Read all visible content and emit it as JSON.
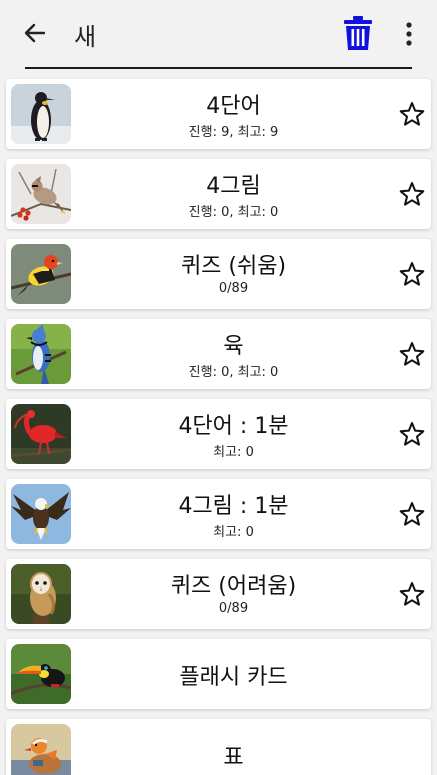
{
  "header": {
    "title": "새",
    "back_icon": "arrow-left-icon",
    "delete_icon": "trash-icon",
    "menu_icon": "more-vert-icon",
    "accent_color": "#1010e0"
  },
  "items": [
    {
      "title": "4단어",
      "subtitle": "진행: 9, 최고: 9",
      "image": "penguin",
      "favorite_icon": "star-outline-icon"
    },
    {
      "title": "4그림",
      "subtitle": "진행: 0, 최고: 0",
      "image": "waxwing",
      "favorite_icon": "star-outline-icon"
    },
    {
      "title": "퀴즈 (쉬움)",
      "subtitle": "0/89",
      "image": "tanager",
      "favorite_icon": "star-outline-icon"
    },
    {
      "title": "육",
      "subtitle": "진행: 0, 최고: 0",
      "image": "blue-jay",
      "favorite_icon": "star-outline-icon"
    },
    {
      "title": "4단어 : 1분",
      "subtitle": "최고: 0",
      "image": "scarlet-ibis",
      "favorite_icon": "star-outline-icon"
    },
    {
      "title": "4그림 : 1분",
      "subtitle": "최고: 0",
      "image": "bald-eagle",
      "favorite_icon": "star-outline-icon"
    },
    {
      "title": "퀴즈 (어려움)",
      "subtitle": "0/89",
      "image": "barn-owl",
      "favorite_icon": "star-outline-icon"
    },
    {
      "title": "플래시 카드",
      "image": "toucan"
    },
    {
      "title": "표",
      "image": "mandarin-duck"
    }
  ]
}
